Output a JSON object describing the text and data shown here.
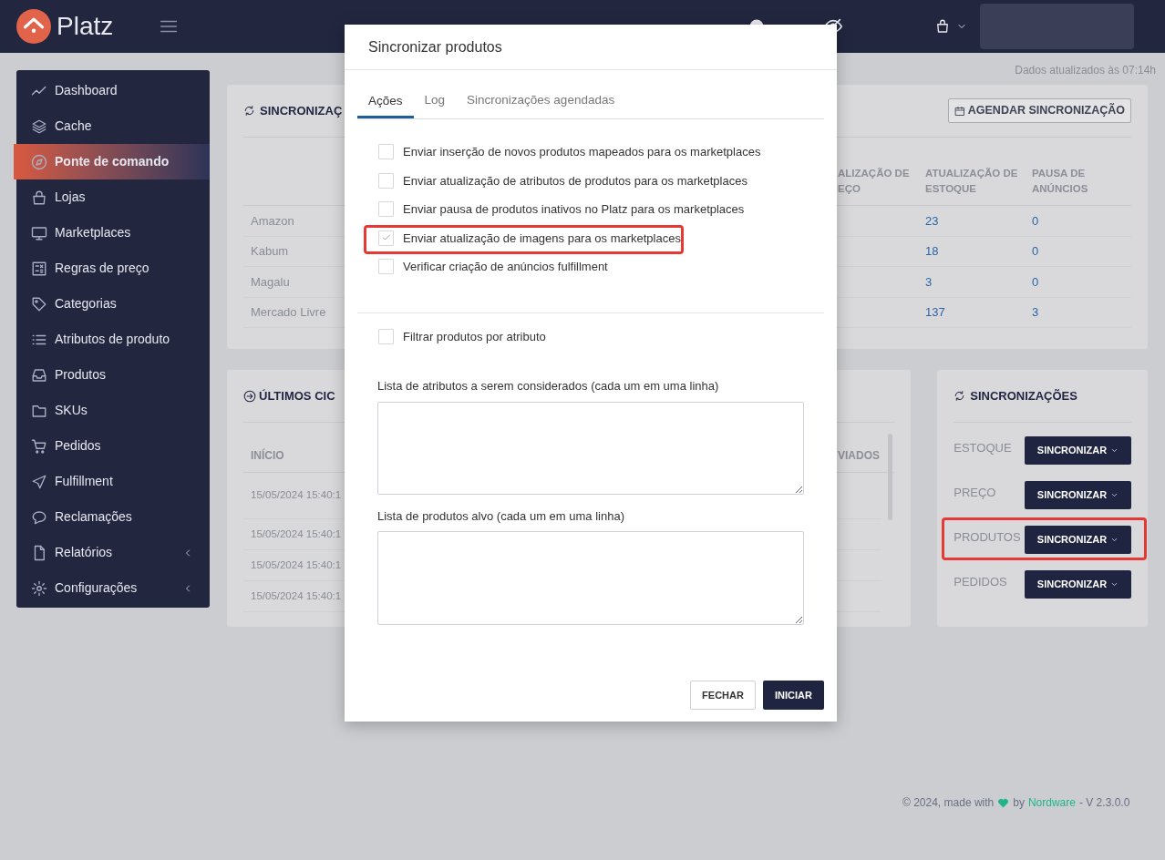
{
  "topbar": {
    "logo_text": "Platz"
  },
  "updated_text": "Dados atualizados às 07:14h",
  "sidebar": {
    "items": [
      {
        "label": "Dashboard",
        "selected": false,
        "has_submenu": false
      },
      {
        "label": "Cache",
        "selected": false,
        "has_submenu": false
      },
      {
        "label": "Ponte de comando",
        "selected": true,
        "has_submenu": false
      },
      {
        "label": "Lojas",
        "selected": false,
        "has_submenu": false
      },
      {
        "label": "Marketplaces",
        "selected": false,
        "has_submenu": false
      },
      {
        "label": "Regras de preço",
        "selected": false,
        "has_submenu": false
      },
      {
        "label": "Categorias",
        "selected": false,
        "has_submenu": false
      },
      {
        "label": "Atributos de produto",
        "selected": false,
        "has_submenu": false
      },
      {
        "label": "Produtos",
        "selected": false,
        "has_submenu": false
      },
      {
        "label": "SKUs",
        "selected": false,
        "has_submenu": false
      },
      {
        "label": "Pedidos",
        "selected": false,
        "has_submenu": false
      },
      {
        "label": "Fulfillment",
        "selected": false,
        "has_submenu": false
      },
      {
        "label": "Reclamações",
        "selected": false,
        "has_submenu": false
      },
      {
        "label": "Relatórios",
        "selected": false,
        "has_submenu": true
      },
      {
        "label": "Configurações",
        "selected": false,
        "has_submenu": true
      }
    ]
  },
  "sync_overview": {
    "title": "SINCRONIZAÇ",
    "schedule_button": "AGENDAR SINCRONIZAÇÃO",
    "columns": [
      "ALIZAÇÃO DE\nEÇO",
      "ATUALIZAÇÃO DE\nESTOQUE",
      "PAUSA DE\nANÚNCIOS"
    ],
    "rows": [
      {
        "marketplace": "Amazon",
        "stock": "23",
        "pause": "0"
      },
      {
        "marketplace": "Kabum",
        "stock": "18",
        "pause": "0"
      },
      {
        "marketplace": "Magalu",
        "stock": "3",
        "pause": "0"
      },
      {
        "marketplace": "Mercado Livre",
        "stock": "137",
        "pause": "3"
      }
    ]
  },
  "last_cycles": {
    "title": "ÚLTIMOS CIC",
    "columns": [
      "INÍCIO",
      "VIADOS"
    ],
    "rows": [
      "15/05/2024 15:40:1",
      "15/05/2024 15:40:1",
      "15/05/2024 15:40:1",
      "15/05/2024 15:40:1"
    ]
  },
  "sync_panel": {
    "title": "SINCRONIZAÇÕES",
    "rows": [
      {
        "label": "ESTOQUE",
        "button": "SINCRONIZAR",
        "highlighted": false
      },
      {
        "label": "PREÇO",
        "button": "SINCRONIZAR",
        "highlighted": false
      },
      {
        "label": "PRODUTOS",
        "button": "SINCRONIZAR",
        "highlighted": true
      },
      {
        "label": "PEDIDOS",
        "button": "SINCRONIZAR",
        "highlighted": false
      }
    ]
  },
  "footer": {
    "text_before": "© 2024, made with",
    "by": "by",
    "link": "Nordware",
    "version": "- V 2.3.0.0"
  },
  "modal": {
    "title": "Sincronizar produtos",
    "tabs": [
      {
        "label": "Ações",
        "selected": true
      },
      {
        "label": "Log",
        "selected": false
      },
      {
        "label": "Sincronizações agendadas",
        "selected": false
      }
    ],
    "actions": [
      {
        "label": "Enviar inserção de novos produtos mapeados para os marketplaces",
        "checked": false,
        "highlighted": false
      },
      {
        "label": "Enviar atualização de atributos de produtos para os marketplaces",
        "checked": false,
        "highlighted": false
      },
      {
        "label": "Enviar pausa de produtos inativos no Platz para os marketplaces",
        "checked": false,
        "highlighted": false
      },
      {
        "label": "Enviar atualização de imagens para os marketplaces",
        "checked": true,
        "highlighted": true
      },
      {
        "label": "Verificar criação de anúncios fulfillment",
        "checked": false,
        "highlighted": false
      }
    ],
    "filter": {
      "label": "Filtrar produtos por atributo",
      "checked": false
    },
    "attributes_label": "Lista de atributos a serem considerados (cada um em uma linha)",
    "products_label": "Lista de produtos alvo (cada um em uma linha)",
    "buttons": {
      "close": "FECHAR",
      "start": "INICIAR"
    }
  }
}
